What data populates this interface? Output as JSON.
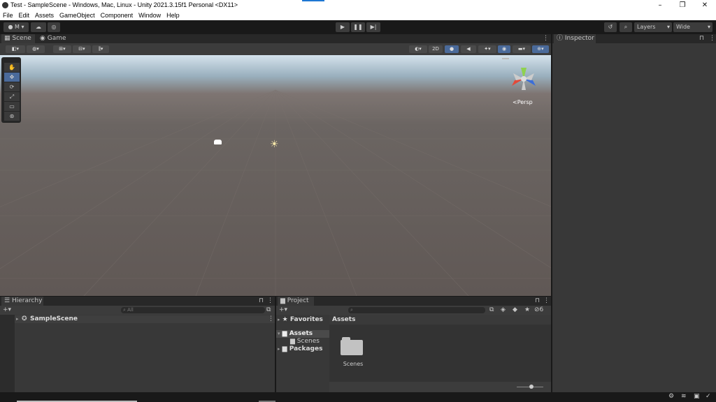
{
  "window": {
    "title": "Test - SampleScene - Windows, Mac, Linux - Unity 2021.3.15f1 Personal <DX11>",
    "min": "–",
    "max": "❐",
    "close": "✕"
  },
  "menu": [
    "File",
    "Edit",
    "Assets",
    "GameObject",
    "Component",
    "Window",
    "Help"
  ],
  "toolbar": {
    "account": "M",
    "layers": "Layers",
    "layout": "Wide"
  },
  "scene_tabs": {
    "scene": "Scene",
    "game": "Game"
  },
  "scene_toolbar": {
    "mode_2d": "2D"
  },
  "gizmo": {
    "persp": "<Persp"
  },
  "inspector": {
    "tab": "Inspector"
  },
  "hierarchy": {
    "tab": "Hierarchy",
    "search_placeholder": "All",
    "scene_name": "SampleScene"
  },
  "project": {
    "tab": "Project",
    "favorites": "Favorites",
    "assets": "Assets",
    "scenes": "Scenes",
    "packages": "Packages",
    "breadcrumb": "Assets",
    "folder_label": "Scenes",
    "hidden_count": "6"
  },
  "colors": {
    "accent": "#4a6a9a",
    "panel": "#383838",
    "toolbar": "#191919"
  }
}
